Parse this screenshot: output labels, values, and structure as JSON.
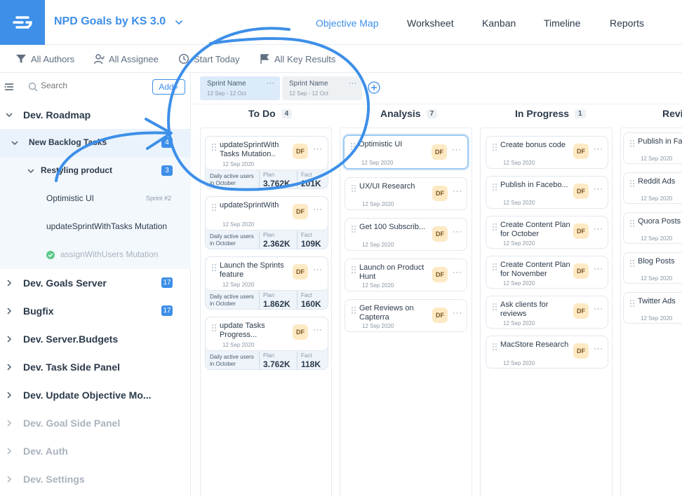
{
  "header": {
    "project_title": "NPD Goals by KS 3.0",
    "tabs": [
      {
        "label": "Objective Map",
        "active": true
      },
      {
        "label": "Worksheet",
        "active": false
      },
      {
        "label": "Kanban",
        "active": false
      },
      {
        "label": "Timeline",
        "active": false
      },
      {
        "label": "Reports",
        "active": false
      }
    ]
  },
  "filters": {
    "authors": "All Authors",
    "assignee": "All Assignee",
    "start": "Start Today",
    "key_results": "All Key Results"
  },
  "sidebar": {
    "search_placeholder": "Search",
    "add_label": "Add+",
    "items": [
      {
        "label": "Dev. Roadmap"
      },
      {
        "label": "New Backlog Tasks",
        "count": "4"
      },
      {
        "label": "Restyling product",
        "count": "3"
      },
      {
        "label": "Optimistic UI",
        "sprint": "Sprint #2"
      },
      {
        "label": "updateSprintWithTasks Mutation"
      },
      {
        "label": "assignWithUsers Mutation"
      },
      {
        "label": "Dev. Goals Server",
        "count": "17"
      },
      {
        "label": "Bugfix",
        "count": "17"
      },
      {
        "label": "Dev. Server.Budgets"
      },
      {
        "label": "Dev. Task Side Panel"
      },
      {
        "label": "Dev. Update Objective Mo..."
      },
      {
        "label": "Dev. Goal Side Panel"
      },
      {
        "label": "Dev. Auth"
      },
      {
        "label": "Dev. Settings"
      }
    ]
  },
  "sprints": [
    {
      "name": "Sprint Name",
      "dates": "12 Sep - 12 Oct"
    },
    {
      "name": "Sprint Name",
      "dates": "12 Sep - 12 Oct"
    }
  ],
  "columns": [
    {
      "title": "To Do",
      "count": "4"
    },
    {
      "title": "Analysis",
      "count": "7"
    },
    {
      "title": "In Progress",
      "count": "1"
    },
    {
      "title": "Revi"
    }
  ],
  "common": {
    "avatar": "DF",
    "date": "12 Sep 2020",
    "more": "···",
    "metric_label": "Daily active users in October",
    "plan": "Plan",
    "fact": "Fact"
  },
  "todo_cards": [
    {
      "title": "updateSprintWith Tasks Mutation..",
      "plan": "3.762K",
      "fact": "201K"
    },
    {
      "title": "updateSprintWith",
      "plan": "2.362K",
      "fact": "109K"
    },
    {
      "title": "Launch the Sprints feature",
      "plan": "1.862K",
      "fact": "160K"
    },
    {
      "title": "update Tasks Progress...",
      "plan": "3.762K",
      "fact": "118K"
    }
  ],
  "analysis_cards": [
    {
      "title": "Optimistic UI"
    },
    {
      "title": "UX/UI Research"
    },
    {
      "title": "Get 100 Subscrib..."
    },
    {
      "title": "Launch on Product Hunt"
    },
    {
      "title": "Get Reviews on Capterra"
    }
  ],
  "progress_cards": [
    {
      "title": "Create bonus code"
    },
    {
      "title": "Publish in Facebo..."
    },
    {
      "title": "Create Content Plan for October"
    },
    {
      "title": "Create Content Plan for November"
    },
    {
      "title": "Ask clients for reviews"
    },
    {
      "title": "MacStore Research"
    }
  ],
  "review_cards": [
    {
      "title": "Publish in Fa"
    },
    {
      "title": "Reddit Ads"
    },
    {
      "title": "Quora Posts"
    },
    {
      "title": "Blog Posts"
    },
    {
      "title": "Twitter Ads"
    }
  ],
  "colors": {
    "accent": "#3d8fe8",
    "avatar_bg": "#fde9c4",
    "sidebar_active": "#eaf3fc"
  }
}
